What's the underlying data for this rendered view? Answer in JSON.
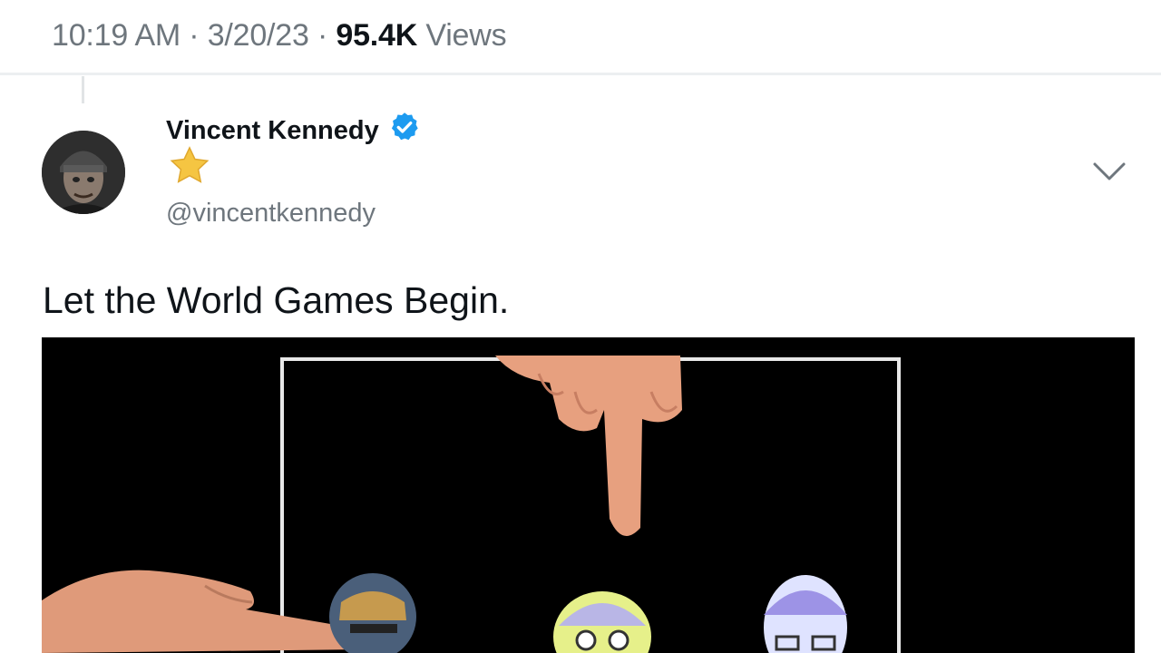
{
  "tweet_meta": {
    "time": "10:19 AM",
    "separator": " · ",
    "date": "3/20/23",
    "views_count": "95.4K",
    "views_label": " Views"
  },
  "author": {
    "name": "Vincent Kennedy",
    "handle": "@vincentkennedy",
    "verified": true,
    "badge_icon": "verified-badge-icon",
    "emoji_icon": "star-icon"
  },
  "tweet": {
    "text": "Let the World Games Begin."
  },
  "colors": {
    "verified_blue": "#1d9bf0",
    "secondary_text": "#6e767d",
    "primary_text": "#0f1419",
    "star_yellow": "#f5c542"
  },
  "media": {
    "type": "video-frame",
    "description_icons": [
      "pointing-finger-icon",
      "hand-icon"
    ]
  }
}
